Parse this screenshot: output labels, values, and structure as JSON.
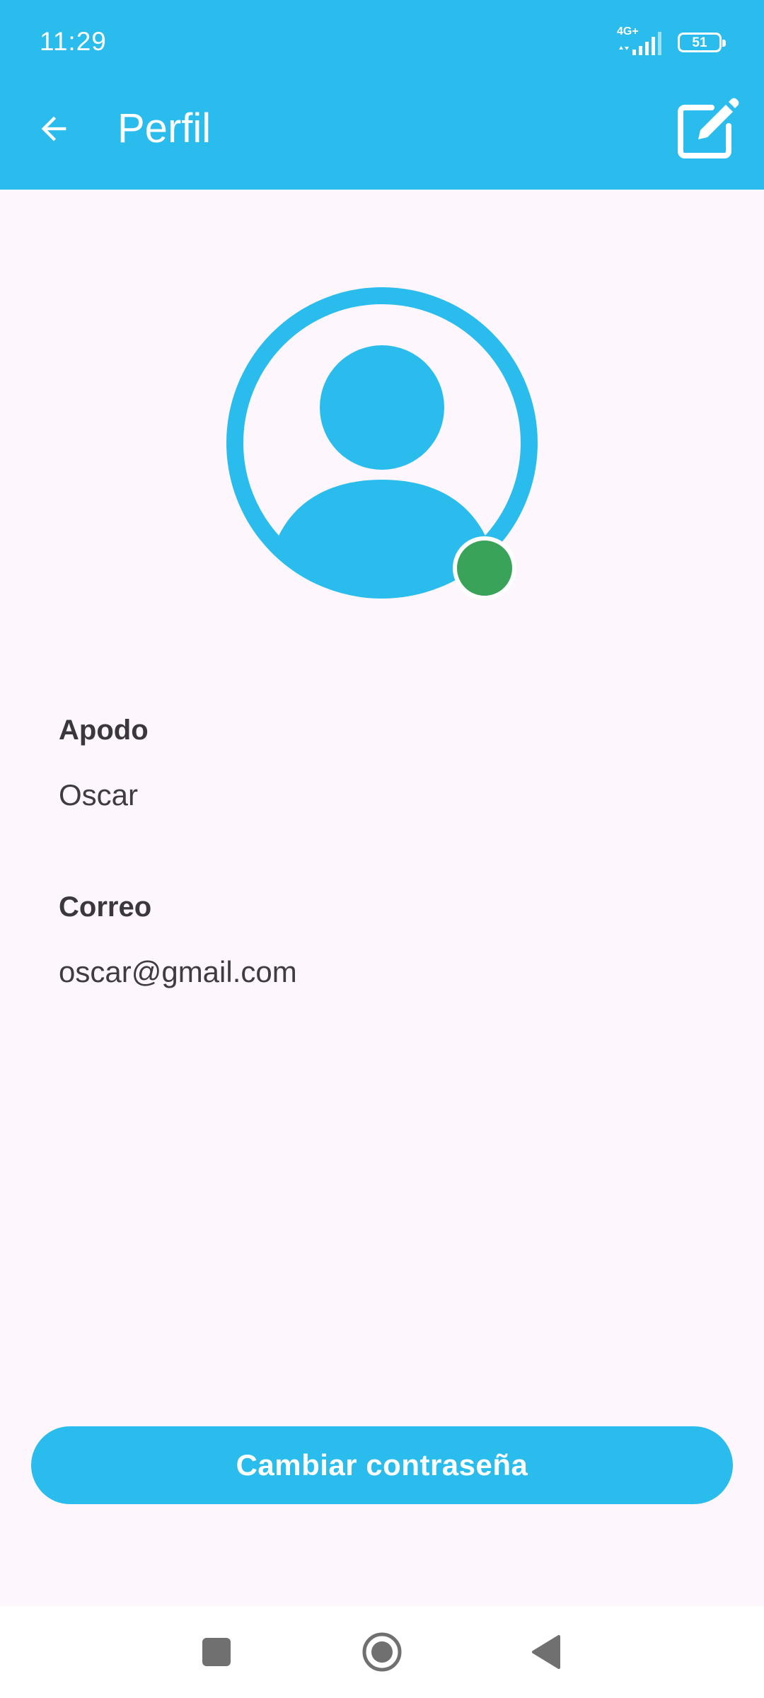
{
  "status_bar": {
    "time": "11:29",
    "network": "4G+",
    "battery_level": "51"
  },
  "app_bar": {
    "title": "Perfil",
    "back_icon": "arrow-left-icon",
    "edit_icon": "edit-icon"
  },
  "profile": {
    "avatar_icon": "account-circle-icon",
    "status": "online",
    "status_color": "#3aa35a",
    "fields": [
      {
        "label": "Apodo",
        "value": "Oscar"
      },
      {
        "label": "Correo",
        "value": "oscar@gmail.com"
      }
    ]
  },
  "actions": {
    "change_password_label": "Cambiar contraseña"
  },
  "nav": {
    "items": [
      "recents-square-icon",
      "home-circle-icon",
      "back-triangle-icon"
    ]
  },
  "colors": {
    "accent": "#2bbcee",
    "background": "#fdf7fd",
    "text": "#3b383d"
  }
}
